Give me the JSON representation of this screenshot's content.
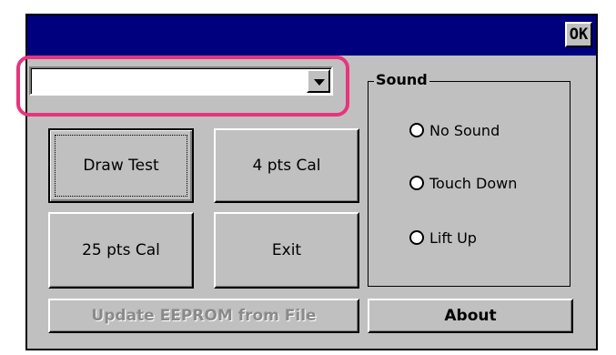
{
  "window": {
    "ok_label": "OK"
  },
  "combo": {
    "value": ""
  },
  "buttons": {
    "draw_test": "Draw Test",
    "four_pts_cal": "4 pts Cal",
    "twentyfive_pts_cal": "25 pts Cal",
    "exit": "Exit",
    "update_eeprom": "Update EEPROM from File",
    "about": "About"
  },
  "sound": {
    "group_label": "Sound",
    "options": [
      {
        "label": "No Sound",
        "selected": false
      },
      {
        "label": "Touch Down",
        "selected": false
      },
      {
        "label": "Lift Up",
        "selected": false
      }
    ]
  },
  "colors": {
    "titlebar": "#00007f",
    "face": "#c0c0c0",
    "highlight_ring": "#e8347b"
  }
}
